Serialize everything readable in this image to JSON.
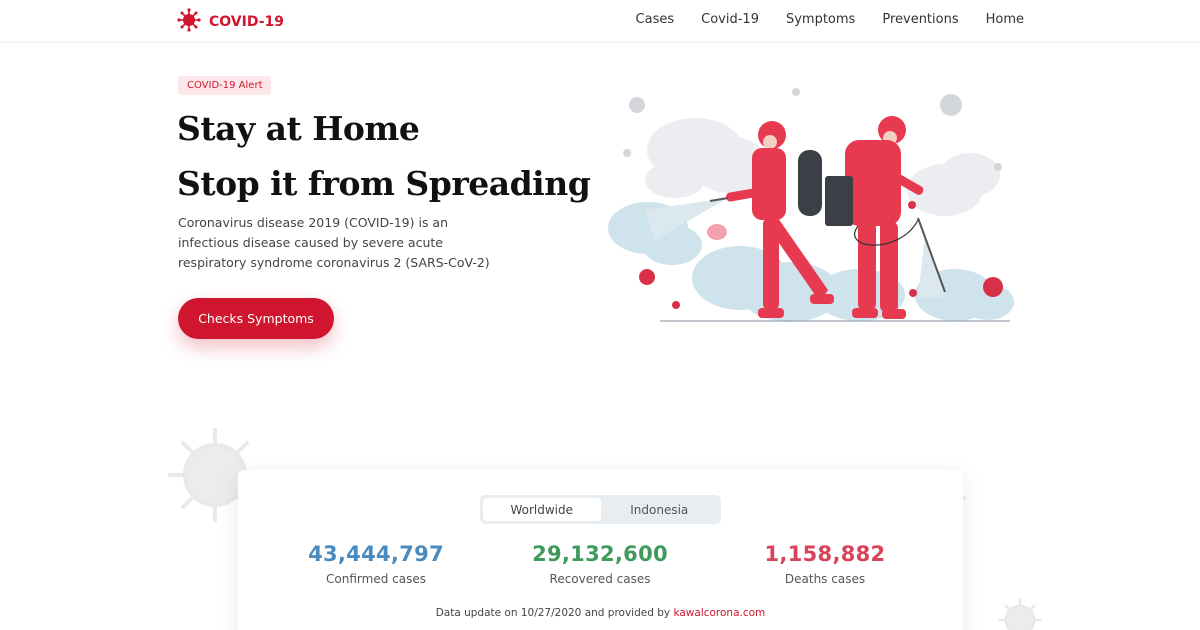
{
  "brand": {
    "name": "COVID-19",
    "color": "#d0162e",
    "icon": "virus-logo-icon"
  },
  "nav": {
    "links": [
      "Cases",
      "Covid-19",
      "Symptoms",
      "Preventions",
      "Home"
    ]
  },
  "hero": {
    "badge": "COVID-19 Alert",
    "title_line1": "Stay at Home",
    "title_line2": "Stop it from Spreading",
    "description": "Coronavirus disease 2019 (COVID-19) is an infectious disease caused by severe acute respiratory syndrome coronavirus 2 (SARS-CoV-2)",
    "cta_label": "Checks Symptoms",
    "illustration": "disinfection-workers-illustration"
  },
  "stats": {
    "tabs": [
      "Worldwide",
      "Indonesia"
    ],
    "active_tab": "Worldwide",
    "confirmed": {
      "value": "43,444,797",
      "label": "Confirmed cases",
      "color": "#4a8bbf"
    },
    "recovered": {
      "value": "29,132,600",
      "label": "Recovered cases",
      "color": "#3f9a5b"
    },
    "deaths": {
      "value": "1,158,882",
      "label": "Deaths cases",
      "color": "#d9435a"
    },
    "update_prefix": "Data update on 10/27/2020 and provided by",
    "update_link": "kawalcorona.com"
  }
}
